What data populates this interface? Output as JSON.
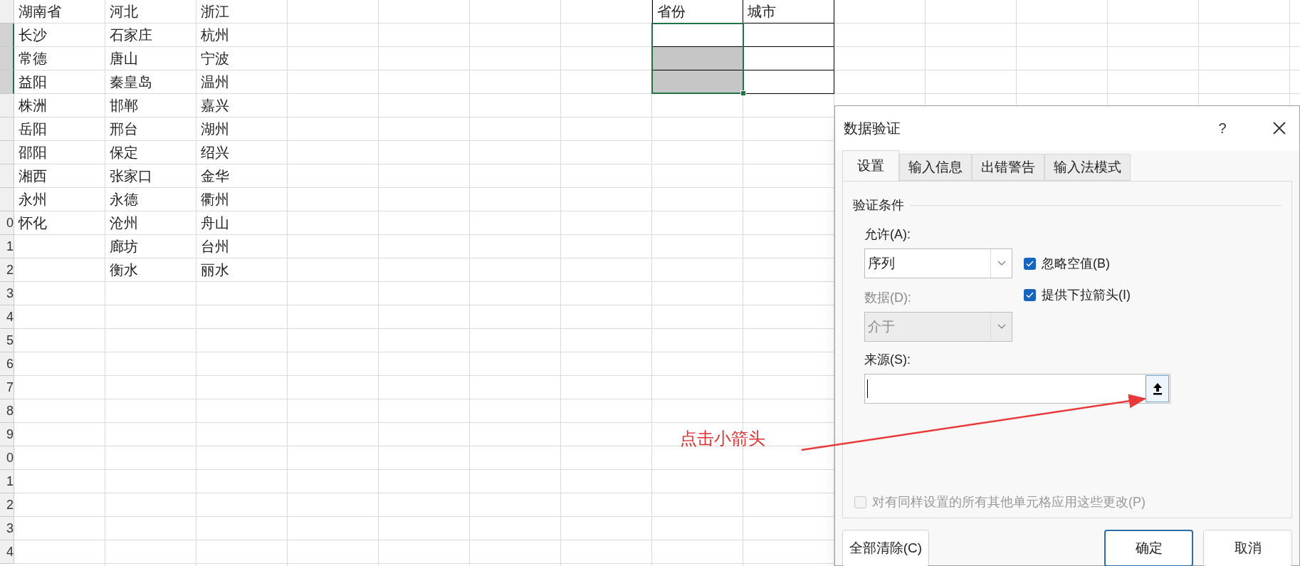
{
  "sheet": {
    "row_headers": [
      {
        "selected": false
      },
      {
        "selected": true
      },
      {
        "selected": true
      },
      {
        "selected": true
      },
      {
        "selected": false
      },
      {
        "selected": false
      },
      {
        "selected": false
      },
      {
        "selected": false
      },
      {
        "selected": false
      },
      {
        "selected": false,
        "label": "0"
      },
      {
        "selected": false,
        "label": "1"
      },
      {
        "selected": false,
        "label": "2"
      },
      {
        "selected": false,
        "label": "3"
      },
      {
        "selected": false,
        "label": "4"
      },
      {
        "selected": false,
        "label": "5"
      },
      {
        "selected": false,
        "label": "6"
      },
      {
        "selected": false,
        "label": "7"
      },
      {
        "selected": false,
        "label": "8"
      },
      {
        "selected": false,
        "label": "9"
      },
      {
        "selected": false,
        "label": "0"
      },
      {
        "selected": false,
        "label": "1"
      },
      {
        "selected": false,
        "label": "2"
      },
      {
        "selected": false,
        "label": "3"
      },
      {
        "selected": false,
        "label": "4"
      }
    ],
    "columns": [
      {
        "cells": [
          "湖南省",
          "长沙",
          "常德",
          "益阳",
          "株洲",
          "岳阳",
          "邵阳",
          "湘西",
          "永州",
          "怀化"
        ]
      },
      {
        "cells": [
          "河北",
          "石家庄",
          "唐山",
          "秦皇岛",
          "邯郸",
          "邢台",
          "保定",
          "张家口",
          "永德",
          "沧州",
          "廊坊",
          "衡水"
        ]
      },
      {
        "cells": [
          "浙江",
          "杭州",
          "宁波",
          "温州",
          "嘉兴",
          "湖州",
          "绍兴",
          "金华",
          "衢州",
          "舟山",
          "台州",
          "丽水"
        ]
      }
    ],
    "validation_table": {
      "headers": [
        "省份",
        "城市"
      ],
      "rows": [
        {
          "selected": true,
          "active": true
        },
        {
          "selected": true,
          "active": false
        },
        {
          "selected": true,
          "active": false
        }
      ]
    }
  },
  "annotation": {
    "text": "点击小箭头"
  },
  "dialog": {
    "title": "数据验证",
    "help": "?",
    "tabs": [
      {
        "label": "设置",
        "selected": true
      },
      {
        "label": "输入信息",
        "selected": false
      },
      {
        "label": "出错警告",
        "selected": false
      },
      {
        "label": "输入法模式",
        "selected": false
      }
    ],
    "group": "验证条件",
    "allow": {
      "label": "允许(A):",
      "value": "序列",
      "disabled": false
    },
    "checkboxes": [
      {
        "label": "忽略空值(B)",
        "checked": true
      },
      {
        "label": "提供下拉箭头(I)",
        "checked": true
      }
    ],
    "data": {
      "label": "数据(D):",
      "value": "介于",
      "disabled": true
    },
    "source": {
      "label": "来源(S):"
    },
    "apply_all": {
      "label": "对有同样设置的所有其他单元格应用这些更改(P)",
      "checked": false,
      "disabled": true
    },
    "buttons": [
      {
        "label": "全部清除(C)",
        "focused": false
      },
      {
        "label": "确定",
        "focused": true
      },
      {
        "label": "取消",
        "focused": false
      }
    ]
  }
}
